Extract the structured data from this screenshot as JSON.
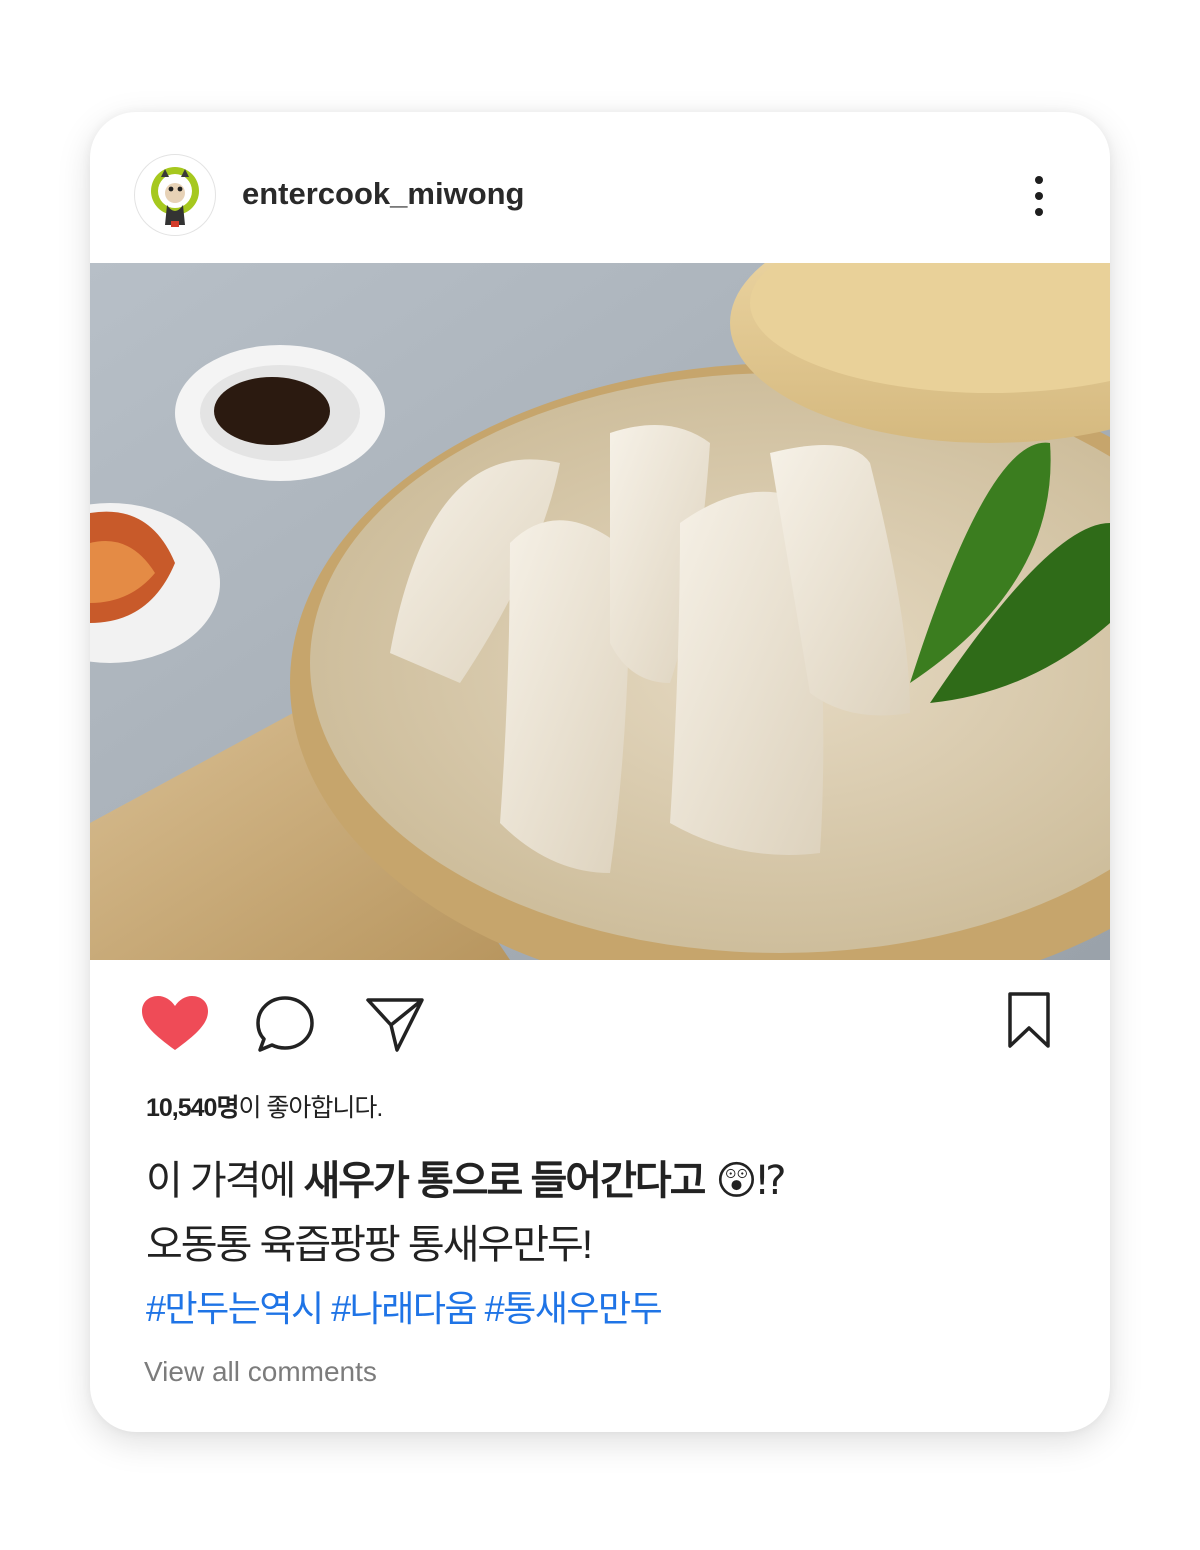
{
  "post": {
    "username": "entercook_miwong",
    "avatar_icon": "cat-mascot-avatar",
    "more_icon": "more-vertical-icon",
    "photo_alt": "",
    "actions": {
      "like_icon": "heart-icon",
      "comment_icon": "comment-icon",
      "share_icon": "send-icon",
      "save_icon": "bookmark-icon",
      "like_color": "#ef4b57"
    },
    "likes_count": "10,540명",
    "likes_suffix": "이 좋아합니다.",
    "caption": {
      "line1_plain": "이 가격에 ",
      "line1_bold": "새우가 통으로 들어간다고",
      "line1_emoji": " 😲⁉",
      "line2": "오동통 육즙팡팡 통새우만두!"
    },
    "hashtags": "#만두는역시 #나래다움 #통새우만두",
    "hashtag_color": "#1f74e6",
    "view_comments": "View all comments"
  }
}
